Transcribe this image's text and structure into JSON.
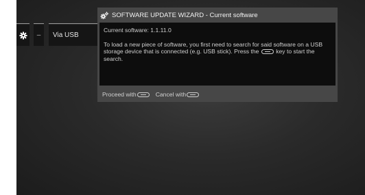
{
  "menu": {
    "dash_label": "–",
    "item_label": "Via USB"
  },
  "dialog": {
    "title": "SOFTWARE UPDATE WIZARD - Current software",
    "current_software": "Current software: 1.1.11.0",
    "instructions_part1": "To load a new piece of software, you first need to search for said software on a USB storage device that is connected (e.g. USB stick). Press the",
    "instructions_part2": "key to start the search.",
    "proceed_label": "Proceed with",
    "cancel_label": "Cancel with"
  },
  "icons": {
    "settings": "gear-icon",
    "wizard": "gears-icon",
    "ok_button": "ok-key-icon",
    "exit_button": "exit-key-icon"
  },
  "colors": {
    "background": "#2a2a2a",
    "dialog": "#474747",
    "dialog_body": "#0d0d0d",
    "menu_item": "#151515"
  }
}
